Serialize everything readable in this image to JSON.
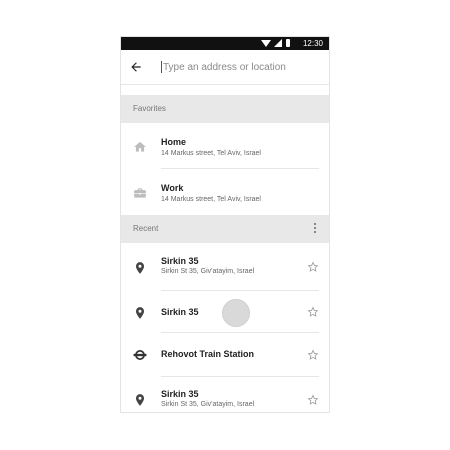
{
  "status_bar": {
    "time": "12:30"
  },
  "search": {
    "placeholder": "Type an address or location"
  },
  "favorites": {
    "header": "Favorites",
    "items": [
      {
        "title": "Home",
        "subtitle": "14 Markus street, Tel Aviv, Israel",
        "icon": "home-icon"
      },
      {
        "title": "Work",
        "subtitle": "14 Markus street, Tel Aviv, Israel",
        "icon": "briefcase-icon"
      }
    ]
  },
  "recent": {
    "header": "Recent",
    "items": [
      {
        "title": "Sirkin 35",
        "subtitle": "Sirkin St 35, Giv'atayim, Israel",
        "icon": "location-pin-icon"
      },
      {
        "title": "Sirkin 35",
        "subtitle": "",
        "icon": "location-pin-icon"
      },
      {
        "title": "Rehovot Train Station",
        "subtitle": "",
        "icon": "train-station-icon"
      },
      {
        "title": "Sirkin 35",
        "subtitle": "Sirkin St 35, Giv'atayim, Israel",
        "icon": "location-pin-icon"
      }
    ]
  }
}
